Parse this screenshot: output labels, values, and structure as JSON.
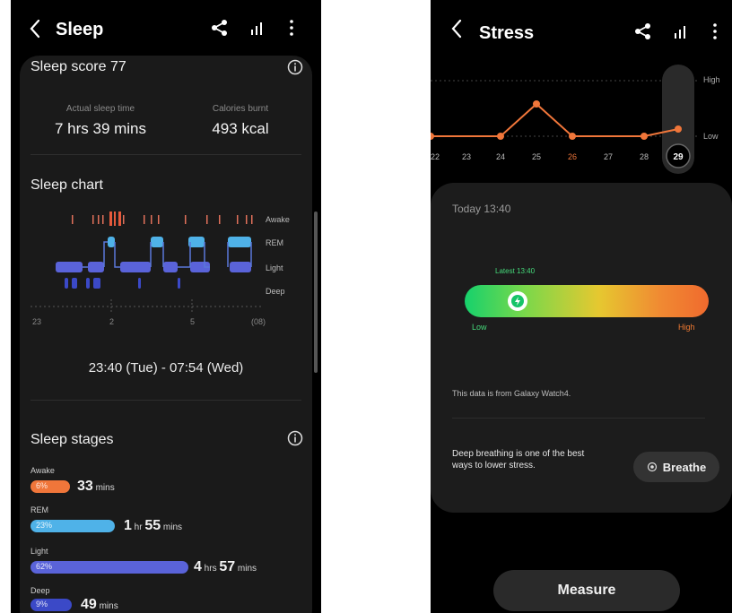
{
  "sleep": {
    "title": "Sleep",
    "score_label": "Sleep score 77",
    "stats": [
      {
        "label": "Actual sleep time",
        "value": "7 hrs 39 mins"
      },
      {
        "label": "Calories burnt",
        "value": "493 kcal"
      }
    ],
    "chart": {
      "title": "Sleep chart",
      "levels": [
        "Awake",
        "REM",
        "Light",
        "Deep"
      ],
      "x_ticks": [
        "23",
        "2",
        "5",
        "(08)"
      ],
      "time_range": "23:40 (Tue) - 07:54 (Wed)"
    },
    "stages": {
      "title": "Sleep stages",
      "items": [
        {
          "label": "Awake",
          "pct": "6%",
          "fill": 0.06,
          "color": "#f0763a",
          "value_num": "33",
          "value_unit": " mins"
        },
        {
          "label": "REM",
          "pct": "23%",
          "fill": 0.23,
          "color": "#4fb2e8",
          "value_num": "1",
          "value_unit": " hr ",
          "value_num2": "55",
          "value_unit2": " mins"
        },
        {
          "label": "Light",
          "pct": "62%",
          "fill": 0.62,
          "color": "#5a63d9",
          "value_num": "4",
          "value_unit": " hrs ",
          "value_num2": "57",
          "value_unit2": " mins"
        },
        {
          "label": "Deep",
          "pct": "9%",
          "fill": 0.09,
          "color": "#3b49c7",
          "value_num": "49",
          "value_unit": " mins"
        }
      ]
    }
  },
  "stress": {
    "title": "Stress",
    "chart": {
      "levels": [
        "High",
        "Low"
      ],
      "days": [
        "22",
        "23",
        "24",
        "25",
        "26",
        "27",
        "28",
        "29"
      ],
      "selected_day": "29"
    },
    "timestamp": "Today 13:40",
    "latest": "Latest 13:40",
    "gauge_value": 0.1,
    "low_label": "Low",
    "high_label": "High",
    "source": "This data is from Galaxy Watch4.",
    "tip": "Deep breathing is one of the best ways to lower stress.",
    "breathe_label": "Breathe",
    "measure_label": "Measure"
  }
}
